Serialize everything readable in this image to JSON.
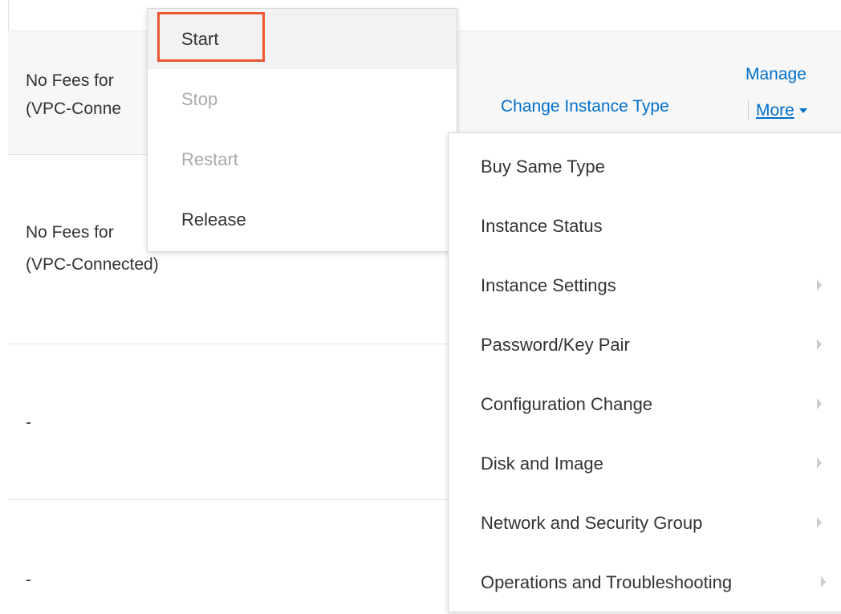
{
  "table": {
    "row1": {
      "fee_line1": "No Fees for",
      "fee_line2": "(VPC-Conne"
    },
    "row2": {
      "fee_line1": "No Fees for",
      "fee_line2": "(VPC-Connected)"
    },
    "row3": {
      "fee": "-"
    },
    "row4": {
      "fee": "-"
    }
  },
  "actions": {
    "manage_label": "Manage",
    "change_type_label": "Change Instance Type",
    "more_label": "More"
  },
  "state_menu": {
    "items": [
      {
        "label": "Start",
        "enabled": true
      },
      {
        "label": "Stop",
        "enabled": false
      },
      {
        "label": "Restart",
        "enabled": false
      },
      {
        "label": "Release",
        "enabled": true
      }
    ]
  },
  "more_menu": {
    "items": [
      {
        "label": "Buy Same Type",
        "submenu": false
      },
      {
        "label": "Instance Status",
        "submenu": false
      },
      {
        "label": "Instance Settings",
        "submenu": true
      },
      {
        "label": "Password/Key Pair",
        "submenu": true
      },
      {
        "label": "Configuration Change",
        "submenu": true
      },
      {
        "label": "Disk and Image",
        "submenu": true
      },
      {
        "label": "Network and Security Group",
        "submenu": true
      },
      {
        "label": "Operations and Troubleshooting",
        "submenu": true
      }
    ]
  },
  "colors": {
    "link": "#0070cc",
    "highlight": "#ee5533",
    "disabled_text": "#aaaaaa"
  }
}
